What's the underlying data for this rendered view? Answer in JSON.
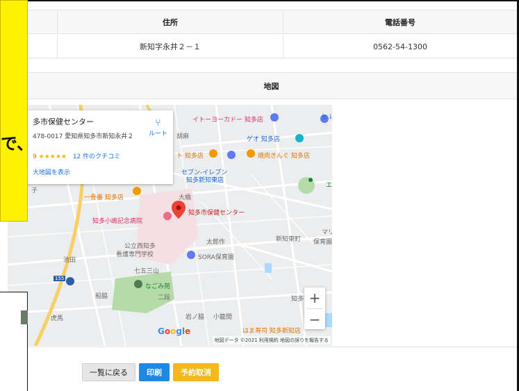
{
  "table": {
    "headers": [
      "",
      "住所",
      "電話番号"
    ],
    "row": [
      "",
      "新知字永井２－１",
      "0562-54-1300"
    ]
  },
  "map_section": {
    "title": "地図",
    "info": {
      "name": "多市保健センター",
      "address": "478-0017 愛知県知多市新知永井２",
      "rating": "9",
      "stars": "★★★★★",
      "reviews": "12 件のクチコミ",
      "larger_map": "大地図を表示",
      "route": "ルート"
    },
    "labels": {
      "itoyokado": "イトーヨーカドー 知多店",
      "seven_top": "セ\nに",
      "geo": "ゲオ 知多店",
      "kurumamiya": "ト 知多店",
      "yakiniku": "焼肉きんぐ 知多店",
      "kurumi": "胡麻",
      "seven": "セブン-イレブン",
      "seven2": "知多新知東店",
      "e": "エ",
      "ikkaku": "一骨番 知多店",
      "ohashi": "大橋",
      "hoken": "知多市保健センター",
      "hospital": "知多小嶋記念病院",
      "tarosaku": "太郎作",
      "shinchihigashi": "新知東町",
      "mari": "マリ",
      "hoiku": "保育園",
      "gakko1": "公立西知多",
      "gakko2": "看護専門学校",
      "sora": "SORA保育園",
      "shichigo": "七五三山",
      "nagomi": "なごみ苑",
      "nido": "二段",
      "funayoko": "船脇",
      "ikenoshiri": "池田",
      "iwanowaki": "岩ノ脇",
      "kogoma": "小籠間",
      "chitashi": "知多市",
      "hamazushi": "はま寿司 知多新知店",
      "tora": "虎馬",
      "ko": "子",
      "road155": "155"
    },
    "google": "Google",
    "attribution": "地図データ ©2021  利用規約  地図の誤りを報告する",
    "zoom_in": "+",
    "zoom_out": "−"
  },
  "buttons": {
    "back": "一覧に戻る",
    "print": "印刷",
    "cancel": "予約取消"
  },
  "callout": {
    "text": "で、"
  },
  "colors": {
    "print_button": "#1e88e5",
    "cancel_button": "#f5b81c",
    "callout_bg": "#fff200",
    "marker": "#ea4335"
  }
}
